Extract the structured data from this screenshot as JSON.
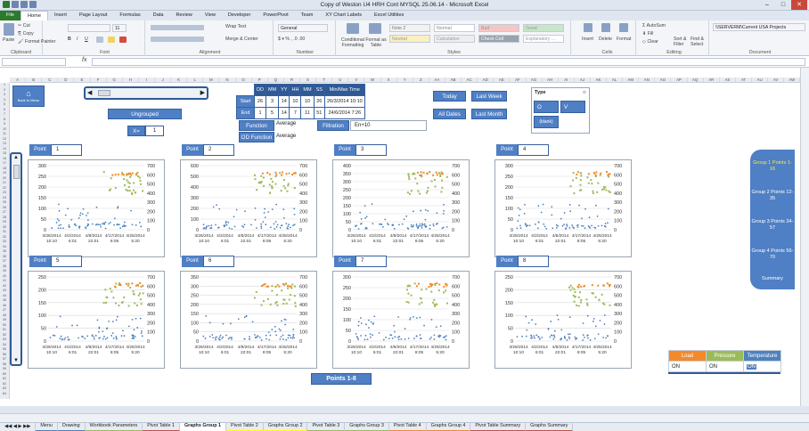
{
  "window": {
    "title": "Copy of Weston U4 HRH Cont MYSQL 25.06.14 - Microsoft Excel"
  },
  "ribbon_tabs": [
    "File",
    "Home",
    "Insert",
    "Page Layout",
    "Formulas",
    "Data",
    "Review",
    "View",
    "Developer",
    "PowerPivot",
    "Team",
    "XY Chart Labels",
    "Excel Utilities"
  ],
  "ribbon": {
    "clipboard": {
      "label": "Clipboard",
      "paste": "Paste",
      "cut": "Cut",
      "copy": "Copy",
      "format_painter": "Format Painter"
    },
    "font": {
      "label": "Font",
      "size": "11"
    },
    "alignment": {
      "label": "Alignment",
      "wrap": "Wrap Text",
      "merge": "Merge & Center"
    },
    "number": {
      "label": "Number",
      "format": "General"
    },
    "styles": {
      "label": "Styles",
      "conditional": "Conditional Formatting",
      "format_table": "Format as Table",
      "cells": [
        "Note 2",
        "Normal",
        "Bad",
        "Good",
        "Neutral",
        "Calculation",
        "Check Cell",
        "Explanatory ..."
      ]
    },
    "cells": {
      "label": "Cells",
      "insert": "Insert",
      "delete": "Delete",
      "format": "Format"
    },
    "editing": {
      "label": "Editing",
      "autosum": "AutoSum",
      "fill": "Fill",
      "clear": "Clear",
      "sort": "Sort & Filter",
      "find": "Find & Select"
    },
    "document": {
      "label": "Document",
      "server": "\\\\SERVERM\\Current USA Projects"
    }
  },
  "formula_bar": {
    "fx": "fx",
    "name": "",
    "formula": ""
  },
  "columns": [
    "A",
    "B",
    "C",
    "D",
    "E",
    "F",
    "G",
    "H",
    "I",
    "J",
    "K",
    "L",
    "M",
    "N",
    "O",
    "P",
    "Q",
    "R",
    "S",
    "T",
    "U",
    "V",
    "W",
    "X",
    "Y",
    "Z",
    "AA",
    "AB",
    "AC",
    "AD",
    "AE",
    "AF",
    "AG",
    "AH",
    "AI",
    "AJ",
    "AK",
    "AL",
    "AM",
    "AN",
    "AO",
    "AP",
    "AQ",
    "AR",
    "AS",
    "AT",
    "AU",
    "AV",
    "AW"
  ],
  "controls": {
    "back_to_menu": "Back to Menu",
    "ungrouped": "Ungrouped",
    "x_label": "X=",
    "x_value": "1",
    "date_headers": [
      "DD",
      "MM",
      "YY",
      "HH",
      "MM",
      "SS",
      "Min/Max Time"
    ],
    "start_label": "Start",
    "start": [
      "26",
      "3",
      "14",
      "10",
      "10",
      "26",
      "26/3/2014 10:10"
    ],
    "end_label": "End",
    "end": [
      "1",
      "5",
      "14",
      "7",
      "11",
      "51",
      "24/6/2014 7:26"
    ],
    "today": "Today",
    "last_week": "Last Week",
    "all_dates": "All Dates",
    "last_month": "Last Month",
    "function_label": "Function",
    "function_value": "Average",
    "od_function_label": "OD Function",
    "od_function_value": "Average",
    "filtration_label": "Filtration",
    "filtration_value": "En+10",
    "type_title": "Type",
    "type_items": [
      "O",
      "V",
      "(blank)"
    ]
  },
  "points": [
    {
      "label": "Point",
      "value": "1"
    },
    {
      "label": "Point",
      "value": "2"
    },
    {
      "label": "Point",
      "value": "3"
    },
    {
      "label": "Point",
      "value": "4"
    },
    {
      "label": "Point",
      "value": "5"
    },
    {
      "label": "Point",
      "value": "6"
    },
    {
      "label": "Point",
      "value": "7"
    },
    {
      "label": "Point",
      "value": "8"
    }
  ],
  "chart_data": [
    {
      "type": "scatter",
      "ylim": [
        0,
        300
      ],
      "y2lim": [
        0,
        700
      ],
      "ytick_labels": [
        "300",
        "250",
        "200",
        "150",
        "100",
        "50",
        "0"
      ],
      "y2tick_labels": [
        "700",
        "600",
        "500",
        "400",
        "300",
        "200",
        "100",
        "0"
      ],
      "xtick_labels": [
        "3/26/2014\n10:10",
        "4/2/2014\n6:01",
        "4/8/2014\n22:01",
        "4/17/2014\n8:05",
        "4/25/2014\n5:20"
      ],
      "xrange": [
        "3/26/2014 10:10",
        "5/1/2014 7:11"
      ],
      "series": [
        {
          "name": "Load",
          "color": "#f28a2b"
        },
        {
          "name": "Pressure",
          "color": "#9bbb59"
        },
        {
          "name": "Temperature",
          "color": "#4f81bd"
        }
      ]
    },
    {
      "type": "scatter",
      "ylim": [
        0,
        600
      ],
      "y2lim": [
        0,
        700
      ],
      "ytick_labels": [
        "600",
        "500",
        "400",
        "300",
        "200",
        "100",
        "0"
      ],
      "y2tick_labels": [
        "700",
        "600",
        "500",
        "400",
        "300",
        "200",
        "100",
        "0"
      ],
      "xtick_labels": [
        "3/26/2014\n10:10",
        "4/2/2014\n6:01",
        "4/8/2014\n22:01",
        "4/17/2014\n8:05",
        "4/25/2014\n5:20"
      ],
      "xrange": [
        "3/26/2014 10:10",
        "5/1/2014 7:11"
      ]
    },
    {
      "type": "scatter",
      "ylim": [
        0,
        400
      ],
      "y2lim": [
        0,
        700
      ],
      "ytick_labels": [
        "400",
        "350",
        "300",
        "250",
        "200",
        "150",
        "100",
        "50",
        "0"
      ],
      "y2tick_labels": [
        "700",
        "600",
        "500",
        "400",
        "300",
        "200",
        "100",
        "0"
      ],
      "xtick_labels": [
        "3/26/2014\n10:10",
        "4/2/2014\n6:01",
        "4/8/2014\n22:01",
        "4/17/2014\n8:05",
        "4/25/2014\n5:20"
      ],
      "xrange": [
        "3/26/2014 10:10",
        "5/1/2014 7:11"
      ]
    },
    {
      "type": "scatter",
      "ylim": [
        0,
        300
      ],
      "y2lim": [
        0,
        700
      ],
      "ytick_labels": [
        "300",
        "250",
        "200",
        "150",
        "100",
        "50",
        "0"
      ],
      "y2tick_labels": [
        "700",
        "600",
        "500",
        "400",
        "300",
        "200",
        "100",
        "0"
      ],
      "xtick_labels": [
        "3/26/2014\n10:10",
        "4/2/2014\n6:01",
        "4/8/2014\n22:01",
        "4/17/2014\n8:05",
        "4/25/2014\n5:20"
      ],
      "xrange": [
        "3/26/2014 10:10",
        "5/1/2014 7:11"
      ]
    },
    {
      "type": "scatter",
      "ylim": [
        0,
        250
      ],
      "y2lim": [
        0,
        700
      ],
      "ytick_labels": [
        "250",
        "200",
        "150",
        "100",
        "50",
        "0"
      ],
      "y2tick_labels": [
        "700",
        "600",
        "500",
        "400",
        "300",
        "200",
        "100",
        "0"
      ],
      "xtick_labels": [
        "3/26/2014\n10:10",
        "4/2/2014\n6:01",
        "4/8/2014\n22:01",
        "4/17/2014\n8:05",
        "4/25/2014\n5:20"
      ],
      "xrange": [
        "3/26/2014 10:10",
        "5/1/2014 7:11"
      ]
    },
    {
      "type": "scatter",
      "ylim": [
        0,
        350
      ],
      "y2lim": [
        0,
        700
      ],
      "ytick_labels": [
        "350",
        "300",
        "250",
        "200",
        "150",
        "100",
        "50",
        "0"
      ],
      "y2tick_labels": [
        "700",
        "600",
        "500",
        "400",
        "300",
        "200",
        "100",
        "0"
      ],
      "xtick_labels": [
        "3/26/2014\n10:10",
        "4/2/2014\n6:01",
        "4/8/2014\n22:01",
        "4/17/2014\n8:05",
        "4/25/2014\n5:20"
      ],
      "xrange": [
        "3/26/2014 10:10",
        "5/1/2014 7:11"
      ]
    },
    {
      "type": "scatter",
      "ylim": [
        0,
        300
      ],
      "y2lim": [
        0,
        700
      ],
      "ytick_labels": [
        "300",
        "250",
        "200",
        "150",
        "100",
        "50",
        "0"
      ],
      "y2tick_labels": [
        "700",
        "600",
        "500",
        "400",
        "300",
        "200",
        "100",
        "0"
      ],
      "xtick_labels": [
        "3/26/2014\n10:10",
        "4/2/2014\n6:01",
        "4/8/2014\n22:01",
        "4/17/2014\n8:05",
        "4/25/2014\n5:20"
      ],
      "xrange": [
        "3/26/2014 10:10",
        "5/1/2014 7:11"
      ]
    },
    {
      "type": "scatter",
      "ylim": [
        0,
        250
      ],
      "y2lim": [
        0,
        700
      ],
      "ytick_labels": [
        "250",
        "200",
        "150",
        "100",
        "50",
        "0"
      ],
      "y2tick_labels": [
        "700",
        "600",
        "500",
        "400",
        "300",
        "200",
        "100",
        "0"
      ],
      "xtick_labels": [
        "3/26/2014\n10:10",
        "4/2/2014\n6:01",
        "4/8/2014\n22:01",
        "4/17/2014\n8:05",
        "4/25/2014\n5:20"
      ],
      "xrange": [
        "3/26/2014 10:10",
        "5/1/2014 7:11"
      ]
    }
  ],
  "right_panel": [
    "Group 1 Points 1-16",
    "Group 2 Points 12-35",
    "Group 3 Points 34-57",
    "Group 4 Points 56-70",
    "Summary"
  ],
  "points_button": "Points 1-8",
  "legend_table": {
    "headers": [
      "Load",
      "Pressure",
      "Temperature"
    ],
    "header_colors": [
      "#f28a2b",
      "#9bbb59",
      "#4f81bd"
    ],
    "values": [
      "ON",
      "ON",
      "ON"
    ]
  },
  "sheet_tabs": [
    {
      "name": "Menu",
      "color": "#4f81bd"
    },
    {
      "name": "Drawing",
      "color": "#4f81bd"
    },
    {
      "name": "Workbook Parameters",
      "color": "#9bbb59"
    },
    {
      "name": "Pivot Table 1",
      "color": "#c0504d"
    },
    {
      "name": "Graphs Group 1",
      "color": "#ffffff"
    },
    {
      "name": "Pivot Table 2",
      "color": "#ffff00"
    },
    {
      "name": "Graphs Group 2",
      "color": "#ffff00"
    },
    {
      "name": "Pivot Table 3",
      "color": "#9bbb59"
    },
    {
      "name": "Graphs Group 3",
      "color": "#9bbb59"
    },
    {
      "name": "Pivot Table 4",
      "color": "#f28a2b"
    },
    {
      "name": "Graphs Group 4",
      "color": "#f28a2b"
    },
    {
      "name": "Pivot Table Summary",
      "color": "#c0504d"
    },
    {
      "name": "Graphs Summary",
      "color": "#c0504d"
    }
  ]
}
